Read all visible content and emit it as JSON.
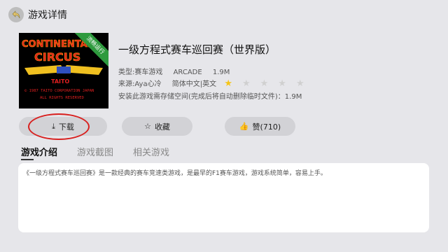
{
  "header": {
    "title": "游戏详情"
  },
  "cover": {
    "badge": "流畅运行"
  },
  "game": {
    "title": "一级方程式赛车巡回赛（世界版）",
    "type": "类型:赛车游戏",
    "platform": "ARCADE",
    "size": "1.9M",
    "source": "来源:Aya心冷",
    "language": "简体中文|英文",
    "rating": 1,
    "rating_max": 5,
    "storage_note": "安装此游戏需存储空间(完成后将自动删除临时文件)：1.9M"
  },
  "actions": {
    "download": "下载",
    "favorite": "收藏",
    "like": "赞(710)"
  },
  "tabs": [
    "游戏介绍",
    "游戏截图",
    "相关游戏"
  ],
  "description": "《一级方程式赛车巡回赛》是一款经典的赛车竞速类游戏，是最早的F1赛车游戏，游戏系统简单，容易上手。",
  "colors": {
    "accent": "#d8201f",
    "badge": "#2e9a3e",
    "star": "#f5c518"
  }
}
